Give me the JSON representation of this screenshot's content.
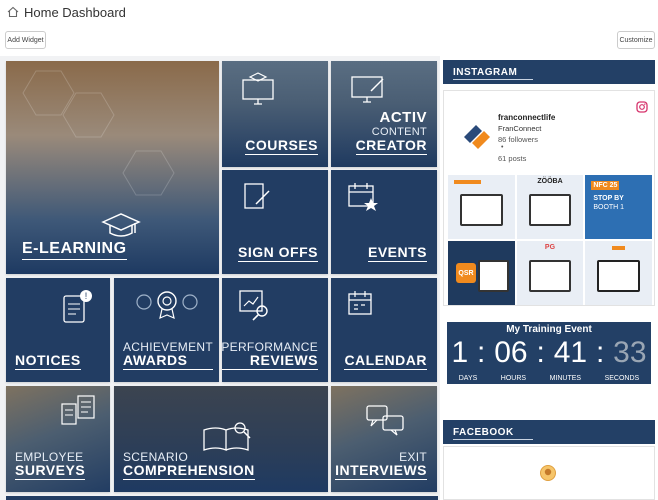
{
  "header": {
    "title": "Home Dashboard",
    "add_widget": "Add Widget",
    "customize": "Customize"
  },
  "tiles": {
    "elearning": {
      "line2": "E-LEARNING"
    },
    "courses": {
      "line2": "COURSES"
    },
    "activ": {
      "line1": "ACTIV",
      "line1b": "CONTENT",
      "line2": "CREATOR"
    },
    "signoffs": {
      "line2": "SIGN OFFS"
    },
    "events": {
      "line2": "EVENTS"
    },
    "notices": {
      "line2": "NOTICES"
    },
    "awards": {
      "line1": "ACHIEVEMENT",
      "line2": "AWARDS"
    },
    "reviews": {
      "line1": "PERFORMANCE",
      "line2": "REVIEWS"
    },
    "calendar": {
      "line2": "CALENDAR"
    },
    "surveys": {
      "line1": "EMPLOYEE",
      "line2": "SURVEYS"
    },
    "comprehension": {
      "line1": "SCENARIO",
      "line2": "COMPREHENSION"
    },
    "interviews": {
      "line1": "EXIT",
      "line2": "INTERVIEWS"
    }
  },
  "instagram": {
    "heading": "INSTAGRAM",
    "handle": "franconnectlife",
    "name": "FranConnect",
    "followers": "86 followers",
    "dot": "•",
    "posts": "61 posts",
    "thumb_labels": [
      "ZÖÖBA",
      "NFC 25",
      "STOP BY",
      "BOOTH 1",
      "QSR",
      "PG"
    ]
  },
  "training_event": {
    "title": "My Training Event",
    "days": "1",
    "hours": "06",
    "minutes": "41",
    "seconds": "33",
    "sep": ":",
    "days_label": "DAYS",
    "hours_label": "HOURS",
    "minutes_label": "MINUTES",
    "seconds_label": "SECONDS"
  },
  "facebook": {
    "heading": "FACEBOOK"
  },
  "colors": {
    "tile": "#223d63",
    "header": "#234066",
    "accent": "#f08a1e"
  }
}
